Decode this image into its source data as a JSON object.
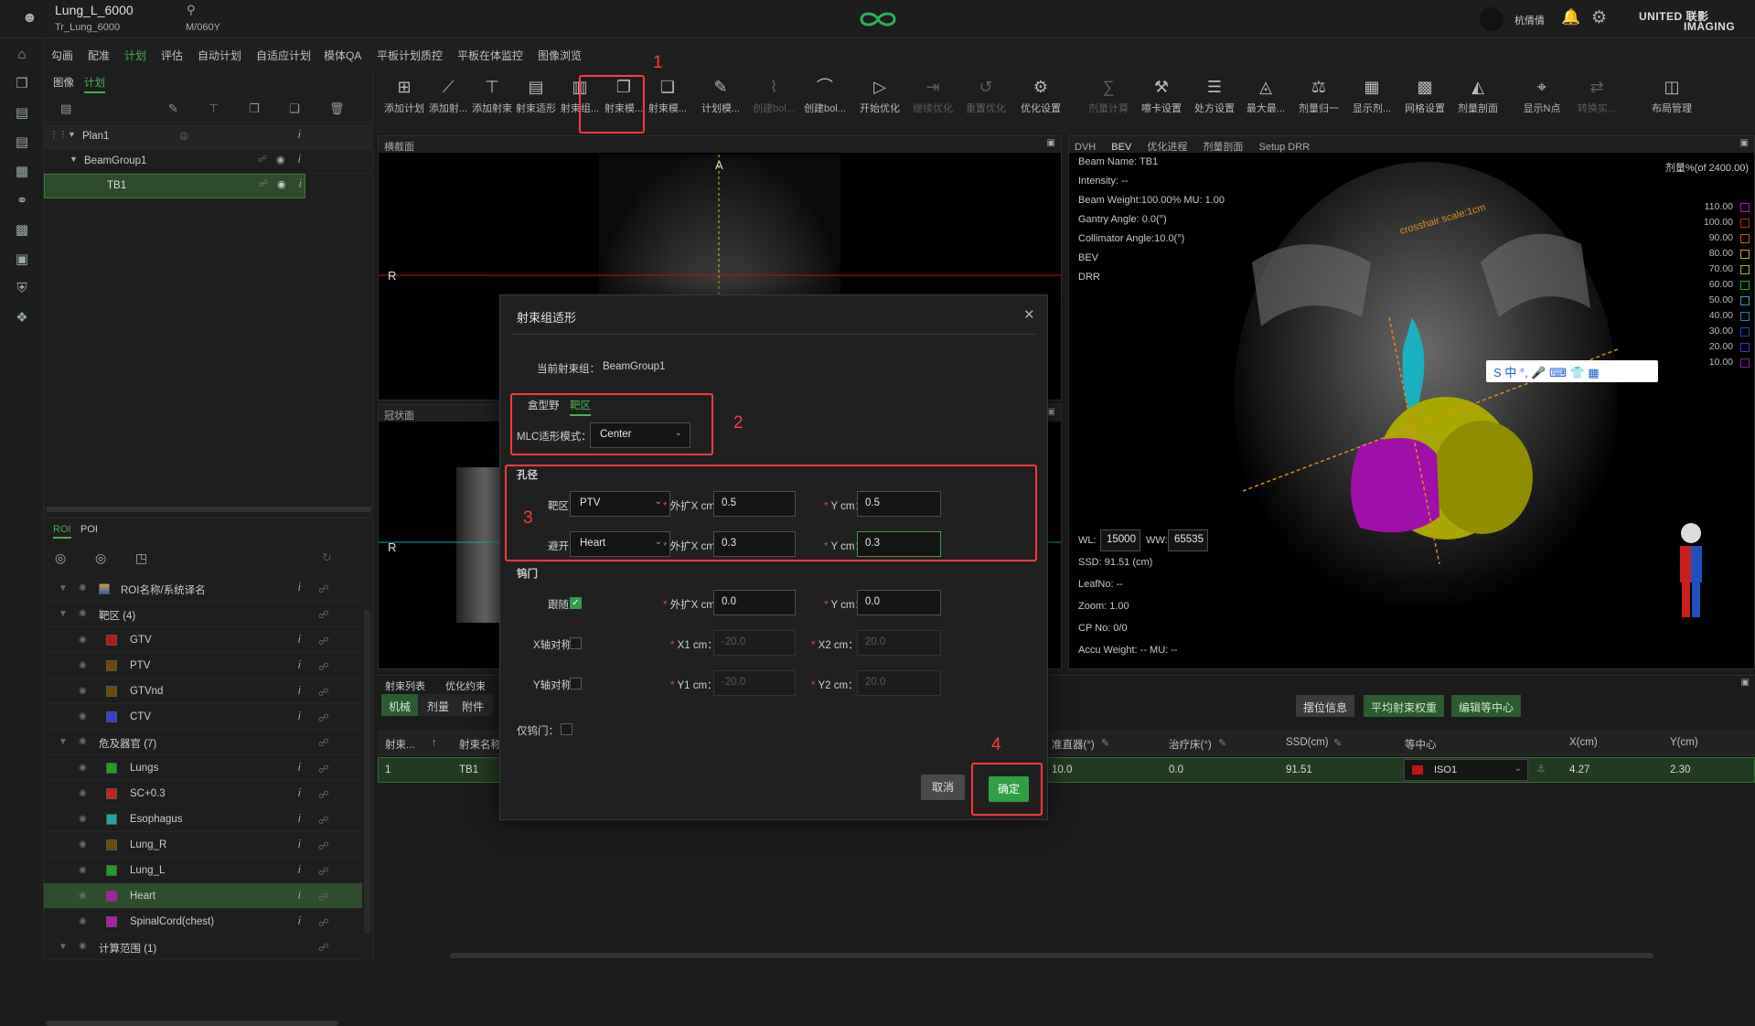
{
  "header": {
    "patient_name": "Lung_L_6000",
    "plan_id": "Tr_Lung_6000",
    "patient_info": "M/060Y",
    "user_name": "杭倩倩",
    "brand_line1": "UNITED 联影",
    "brand_line2": "IMAGING"
  },
  "menu": {
    "items": [
      "勾画",
      "配准",
      "计划",
      "评估",
      "自动计划",
      "自适应计划",
      "模体QA",
      "平板计划质控",
      "平板在体监控",
      "图像浏览"
    ],
    "active_index": 2
  },
  "left_panel": {
    "tabs": [
      "图像",
      "计划"
    ],
    "active_tab": 1,
    "plan_tree": [
      {
        "label": "Plan1",
        "level": 0
      },
      {
        "label": "BeamGroup1",
        "level": 1
      },
      {
        "label": "TB1",
        "level": 2,
        "selected": true
      }
    ],
    "roi_tabs": [
      "ROI",
      "POI"
    ],
    "roi_header": "ROI名称/系统译名",
    "roi_groups": [
      {
        "label": "靶区 (4)",
        "items": [
          {
            "name": "GTV",
            "color": "#c01515"
          },
          {
            "name": "PTV",
            "color": "#6b4a00"
          },
          {
            "name": "GTVnd",
            "color": "#6b4a00"
          },
          {
            "name": "CTV",
            "color": "#3b3bd8"
          }
        ]
      },
      {
        "label": "危及器官 (7)",
        "items": [
          {
            "name": "Lungs",
            "color": "#1f9e1f"
          },
          {
            "name": "SC+0.3",
            "color": "#c82020"
          },
          {
            "name": "Esophagus",
            "color": "#1fa6a6"
          },
          {
            "name": "Lung_R",
            "color": "#6b4a00"
          },
          {
            "name": "Lung_L",
            "color": "#1f9e1f"
          },
          {
            "name": "Heart",
            "color": "#b01ab0",
            "selected": true
          },
          {
            "name": "SpinalCord(chest)",
            "color": "#b01ab0"
          }
        ]
      },
      {
        "label": "计算范围 (1)",
        "items": []
      }
    ]
  },
  "toolbar": {
    "tools": [
      {
        "label": "添加计划",
        "glyph": "⊞",
        "dim": false
      },
      {
        "label": "添加射...",
        "glyph": "⟋",
        "dim": false
      },
      {
        "label": "添加射束",
        "glyph": "⊤",
        "dim": false
      },
      {
        "label": "射束适形",
        "glyph": "▤",
        "dim": false
      },
      {
        "label": "射束组...",
        "glyph": "▥",
        "dim": false
      },
      {
        "label": "射束模...",
        "glyph": "❐",
        "dim": false
      },
      {
        "label": "射束模...",
        "glyph": "❏",
        "dim": false
      },
      {
        "label": "计划模...",
        "glyph": "✎",
        "dim": false
      },
      {
        "label": "创建bol...",
        "glyph": "⌇",
        "dim": true
      },
      {
        "label": "创建bol...",
        "glyph": "⌒",
        "dim": false
      },
      {
        "label": "开始优化",
        "glyph": "▷",
        "dim": false
      },
      {
        "label": "继续优化",
        "glyph": "⇥",
        "dim": true
      },
      {
        "label": "重置优化",
        "glyph": "↺",
        "dim": true
      },
      {
        "label": "优化设置",
        "glyph": "⚙",
        "dim": false
      },
      {
        "label": "剂量计算",
        "glyph": "∑",
        "dim": true
      },
      {
        "label": "嚓卡设置",
        "glyph": "⚒",
        "dim": false
      },
      {
        "label": "处方设置",
        "glyph": "☰",
        "dim": false
      },
      {
        "label": "最大最...",
        "glyph": "◬",
        "dim": false
      },
      {
        "label": "剂量归一",
        "glyph": "⚖",
        "dim": false
      },
      {
        "label": "显示剂...",
        "glyph": "▦",
        "dim": false
      },
      {
        "label": "网格设置",
        "glyph": "▩",
        "dim": false
      },
      {
        "label": "剂量剖面",
        "glyph": "◭",
        "dim": false
      },
      {
        "label": "显示N点",
        "glyph": "⌖",
        "dim": false
      },
      {
        "label": "转换实...",
        "glyph": "⇄",
        "dim": true
      },
      {
        "label": "布局管理",
        "glyph": "◫",
        "dim": false
      }
    ]
  },
  "views": {
    "axial_title": "横截面",
    "coronal_title": "冠状面",
    "orient_a": "A",
    "orient_r": "R",
    "right_tabs": [
      "DVH",
      "BEV",
      "优化进程",
      "剂量剖面",
      "Setup DRR"
    ],
    "bev_info": [
      "Beam Name: TB1",
      "Intensity: --",
      "Beam Weight:100.00% MU: 1.00",
      "Gantry Angle: 0.0(°)",
      "Collimator Angle:10.0(°)",
      "BEV",
      "DRR"
    ],
    "bev_bottom_info": [
      "SSD: 91.51 (cm)",
      "LeafNo: --",
      "Zoom: 1.00",
      "CP No: 0/0",
      "Accu Weight: -- MU: --"
    ],
    "wl_label": "WL:",
    "wl_value": "15000",
    "ww_label": "WW:",
    "ww_value": "65535",
    "crosshair_label": "crosshair scale:1cm",
    "dose_legend_title": "剂量%(of 2400.00)",
    "dose_levels": [
      {
        "value": "110.00",
        "color": "#b01ab0"
      },
      {
        "value": "100.00",
        "color": "#d02020"
      },
      {
        "value": "90.00",
        "color": "#d05a00"
      },
      {
        "value": "80.00",
        "color": "#d0a000"
      },
      {
        "value": "70.00",
        "color": "#a0c000"
      },
      {
        "value": "60.00",
        "color": "#20b020"
      },
      {
        "value": "50.00",
        "color": "#20b0a0"
      },
      {
        "value": "40.00",
        "color": "#2080d0"
      },
      {
        "value": "30.00",
        "color": "#2040d0"
      },
      {
        "value": "20.00",
        "color": "#6020d0"
      },
      {
        "value": "10.00",
        "color": "#8020a0"
      }
    ],
    "ime_bar": "S 中 °, 🎤 ⌨ 👕 ▦"
  },
  "beam_table": {
    "top_tabs": [
      "射束列表",
      "优化约束"
    ],
    "sub_tabs": [
      "机械",
      "剂量",
      "附件"
    ],
    "right_buttons": [
      "摆位信息",
      "平均射束权重",
      "编辑等中心"
    ],
    "columns": [
      "射束...",
      "射束名称",
      "准直器(°)",
      "治疗床(°)",
      "SSD(cm)",
      "等中心",
      "X(cm)",
      "Y(cm)"
    ],
    "rows": [
      {
        "index": "1",
        "name": "TB1",
        "collimator": "10.0",
        "couch": "0.0",
        "ssd": "91.51",
        "isocenter": "ISO1",
        "x": "4.27",
        "y": "2.30"
      }
    ]
  },
  "dialog": {
    "title": "射束组适形",
    "current_group_label": "当前射束组：",
    "current_group_value": "BeamGroup1",
    "mode_tabs": [
      "盒型野",
      "靶区"
    ],
    "active_mode": 1,
    "mlc_mode_label": "MLC适形模式：",
    "mlc_mode_value": "Center",
    "aperture_title": "孔径",
    "target_label": "靶区：",
    "target_value": "PTV",
    "avoid_label": "避开：",
    "avoid_value": "Heart",
    "expand_x_label": "外扩X cm：",
    "y_cm_label": "Y cm：",
    "target_x": "0.5",
    "target_y": "0.5",
    "avoid_x": "0.3",
    "avoid_y": "0.3",
    "jaw_title": "钨门",
    "follow_label": "跟随：",
    "jaw_x": "0.0",
    "jaw_y": "0.0",
    "x_sym_label": "X轴对称：",
    "x1_label": "X1 cm：",
    "x2_label": "X2 cm：",
    "x1_value": "-20.0",
    "x2_value": "20.0",
    "y_sym_label": "Y轴对称：",
    "y1_label": "Y1 cm：",
    "y2_label": "Y2 cm：",
    "y1_value": "-20.0",
    "y2_value": "20.0",
    "jaw_only_label": "仅钨门：",
    "cancel_label": "取消",
    "ok_label": "确定"
  },
  "annotations": [
    "1",
    "2",
    "3",
    "4"
  ]
}
